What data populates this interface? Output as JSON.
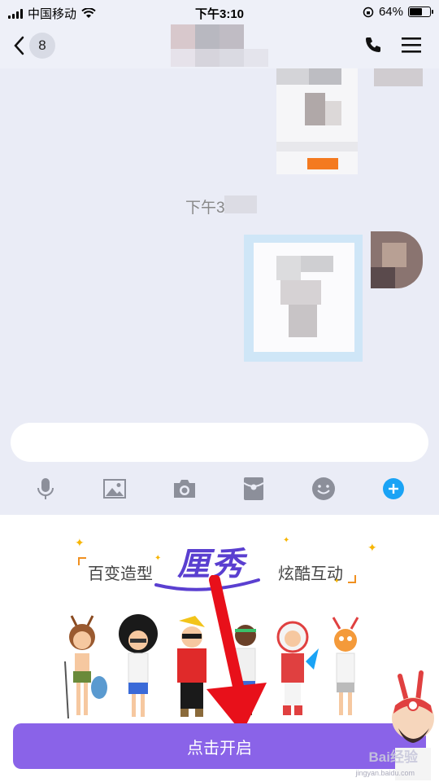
{
  "status_bar": {
    "carrier": "中国移动",
    "time": "下午3:10",
    "battery": "64%",
    "battery_level": 0.64
  },
  "header": {
    "back_badge": "8",
    "icons": [
      "back-chevron-icon",
      "phone-icon",
      "menu-icon"
    ]
  },
  "chat": {
    "time_label": "下午3"
  },
  "input": {
    "placeholder": ""
  },
  "toolbar": {
    "icons": [
      "microphone-icon",
      "image-icon",
      "camera-icon",
      "red-packet-icon",
      "emoji-icon",
      "plus-icon"
    ],
    "accent": "#1aa3f5"
  },
  "promo": {
    "slogan_left": "百变造型",
    "slogan_right": "炫酷互动",
    "logo": "厘秀",
    "button_label": "点击开启",
    "button_color": "#8a63e8",
    "characters": 7
  },
  "watermark": {
    "text": "Bai经验",
    "url": "jingyan.baidu.com"
  }
}
